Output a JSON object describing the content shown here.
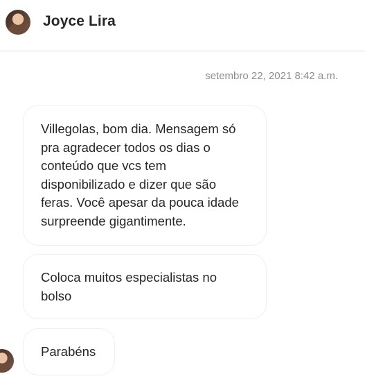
{
  "header": {
    "contact_name": "Joyce Lira"
  },
  "thread": {
    "timestamp": "setembro 22, 2021 8:42 a.m.",
    "messages": [
      {
        "text": "Villegolas, bom dia. Mensagem só pra agradecer todos os dias o conteúdo que vcs tem disponibilizado e dizer que são feras. Você apesar da pouca idade surpreende gigantimente."
      },
      {
        "text": "Coloca muitos especialistas no bolso"
      },
      {
        "text": "Parabéns"
      }
    ]
  },
  "colors": {
    "divider": "#dbdbdb",
    "timestamp": "#8e8e8e",
    "bubble_border": "#efefef",
    "text": "#262626"
  }
}
